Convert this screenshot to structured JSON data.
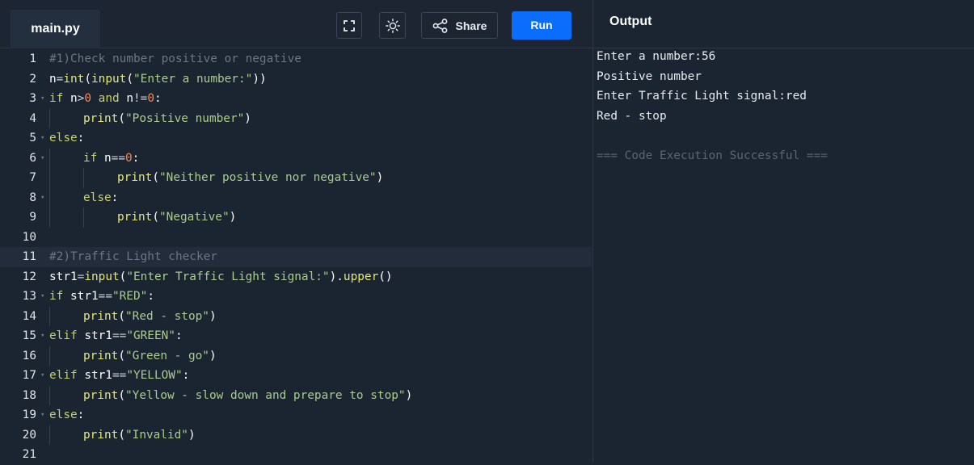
{
  "editor": {
    "file_tab": "main.py",
    "toolbar": {
      "fullscreen_icon": "fullscreen-icon",
      "theme_icon": "sun-icon",
      "share_icon": "share-icon",
      "share_label": "Share",
      "run_label": "Run"
    },
    "lines": [
      {
        "n": "1",
        "fold": "",
        "indent": 0,
        "tokens": [
          [
            "#1)Check number positive or negative",
            "com"
          ]
        ]
      },
      {
        "n": "2",
        "fold": "",
        "indent": 0,
        "tokens": [
          [
            "n",
            "id"
          ],
          [
            "=",
            "op"
          ],
          [
            "int",
            "fn"
          ],
          [
            "(",
            "id"
          ],
          [
            "input",
            "fn"
          ],
          [
            "(",
            "id"
          ],
          [
            "\"Enter a number:\"",
            "str"
          ],
          [
            "))",
            "id"
          ]
        ]
      },
      {
        "n": "3",
        "fold": "▾",
        "indent": 0,
        "tokens": [
          [
            "if",
            "kw"
          ],
          [
            " n",
            "id"
          ],
          [
            ">",
            "op"
          ],
          [
            "0",
            "num"
          ],
          [
            " and ",
            "kw"
          ],
          [
            "n",
            "id"
          ],
          [
            "!=",
            "op"
          ],
          [
            "0",
            "num"
          ],
          [
            ":",
            "id"
          ]
        ]
      },
      {
        "n": "4",
        "fold": "",
        "indent": 1,
        "tokens": [
          [
            "print",
            "fn"
          ],
          [
            "(",
            "id"
          ],
          [
            "\"Positive number\"",
            "str"
          ],
          [
            ")",
            "id"
          ]
        ]
      },
      {
        "n": "5",
        "fold": "▾",
        "indent": 0,
        "tokens": [
          [
            "else",
            "kw"
          ],
          [
            ":",
            "id"
          ]
        ]
      },
      {
        "n": "6",
        "fold": "▾",
        "indent": 1,
        "tokens": [
          [
            "if",
            "kw"
          ],
          [
            " n",
            "id"
          ],
          [
            "==",
            "op"
          ],
          [
            "0",
            "num"
          ],
          [
            ":",
            "id"
          ]
        ]
      },
      {
        "n": "7",
        "fold": "",
        "indent": 2,
        "tokens": [
          [
            "print",
            "fn"
          ],
          [
            "(",
            "id"
          ],
          [
            "\"Neither positive nor negative\"",
            "str"
          ],
          [
            ")",
            "id"
          ]
        ]
      },
      {
        "n": "8",
        "fold": "▾",
        "indent": 1,
        "tokens": [
          [
            "else",
            "kw"
          ],
          [
            ":",
            "id"
          ]
        ]
      },
      {
        "n": "9",
        "fold": "",
        "indent": 2,
        "tokens": [
          [
            "print",
            "fn"
          ],
          [
            "(",
            "id"
          ],
          [
            "\"Negative\"",
            "str"
          ],
          [
            ")",
            "id"
          ]
        ]
      },
      {
        "n": "10",
        "fold": "",
        "indent": 0,
        "tokens": []
      },
      {
        "n": "11",
        "fold": "",
        "indent": 0,
        "active": true,
        "tokens": [
          [
            "#2)Traffic Light checker",
            "com"
          ]
        ]
      },
      {
        "n": "12",
        "fold": "",
        "indent": 0,
        "tokens": [
          [
            "str1",
            "id"
          ],
          [
            "=",
            "op"
          ],
          [
            "input",
            "fn"
          ],
          [
            "(",
            "id"
          ],
          [
            "\"Enter Traffic Light signal:\"",
            "str"
          ],
          [
            ").",
            "id"
          ],
          [
            "upper",
            "fn"
          ],
          [
            "()",
            "id"
          ]
        ]
      },
      {
        "n": "13",
        "fold": "▾",
        "indent": 0,
        "tokens": [
          [
            "if",
            "kw"
          ],
          [
            " str1",
            "id"
          ],
          [
            "==",
            "op"
          ],
          [
            "\"RED\"",
            "str"
          ],
          [
            ":",
            "id"
          ]
        ]
      },
      {
        "n": "14",
        "fold": "",
        "indent": 1,
        "tokens": [
          [
            "print",
            "fn"
          ],
          [
            "(",
            "id"
          ],
          [
            "\"Red - stop\"",
            "str"
          ],
          [
            ")",
            "id"
          ]
        ]
      },
      {
        "n": "15",
        "fold": "▾",
        "indent": 0,
        "tokens": [
          [
            "elif",
            "kw"
          ],
          [
            " str1",
            "id"
          ],
          [
            "==",
            "op"
          ],
          [
            "\"GREEN\"",
            "str"
          ],
          [
            ":",
            "id"
          ]
        ]
      },
      {
        "n": "16",
        "fold": "",
        "indent": 1,
        "tokens": [
          [
            "print",
            "fn"
          ],
          [
            "(",
            "id"
          ],
          [
            "\"Green - go\"",
            "str"
          ],
          [
            ")",
            "id"
          ]
        ]
      },
      {
        "n": "17",
        "fold": "▾",
        "indent": 0,
        "tokens": [
          [
            "elif",
            "kw"
          ],
          [
            " str1",
            "id"
          ],
          [
            "==",
            "op"
          ],
          [
            "\"YELLOW\"",
            "str"
          ],
          [
            ":",
            "id"
          ]
        ]
      },
      {
        "n": "18",
        "fold": "",
        "indent": 1,
        "tokens": [
          [
            "print",
            "fn"
          ],
          [
            "(",
            "id"
          ],
          [
            "\"Yellow - slow down and prepare to stop\"",
            "str"
          ],
          [
            ")",
            "id"
          ]
        ]
      },
      {
        "n": "19",
        "fold": "▾",
        "indent": 0,
        "tokens": [
          [
            "else",
            "kw"
          ],
          [
            ":",
            "id"
          ]
        ]
      },
      {
        "n": "20",
        "fold": "",
        "indent": 1,
        "tokens": [
          [
            "print",
            "fn"
          ],
          [
            "(",
            "id"
          ],
          [
            "\"Invalid\"",
            "str"
          ],
          [
            ")",
            "id"
          ]
        ]
      },
      {
        "n": "21",
        "fold": "",
        "indent": 0,
        "tokens": []
      }
    ]
  },
  "output": {
    "title": "Output",
    "lines": [
      {
        "text": "Enter a number:56",
        "dim": false
      },
      {
        "text": "Positive number",
        "dim": false
      },
      {
        "text": "Enter Traffic Light signal:red",
        "dim": false
      },
      {
        "text": "Red - stop",
        "dim": false
      },
      {
        "text": "",
        "dim": false
      },
      {
        "text": "=== Code Execution Successful ===",
        "dim": true
      }
    ]
  },
  "colors": {
    "background": "#1b2431",
    "run_button": "#0b6dfc",
    "comment": "#6d7683",
    "keyword": "#c7d174",
    "function": "#e3e77e",
    "string": "#aacd8c",
    "number": "#f08a5d"
  }
}
